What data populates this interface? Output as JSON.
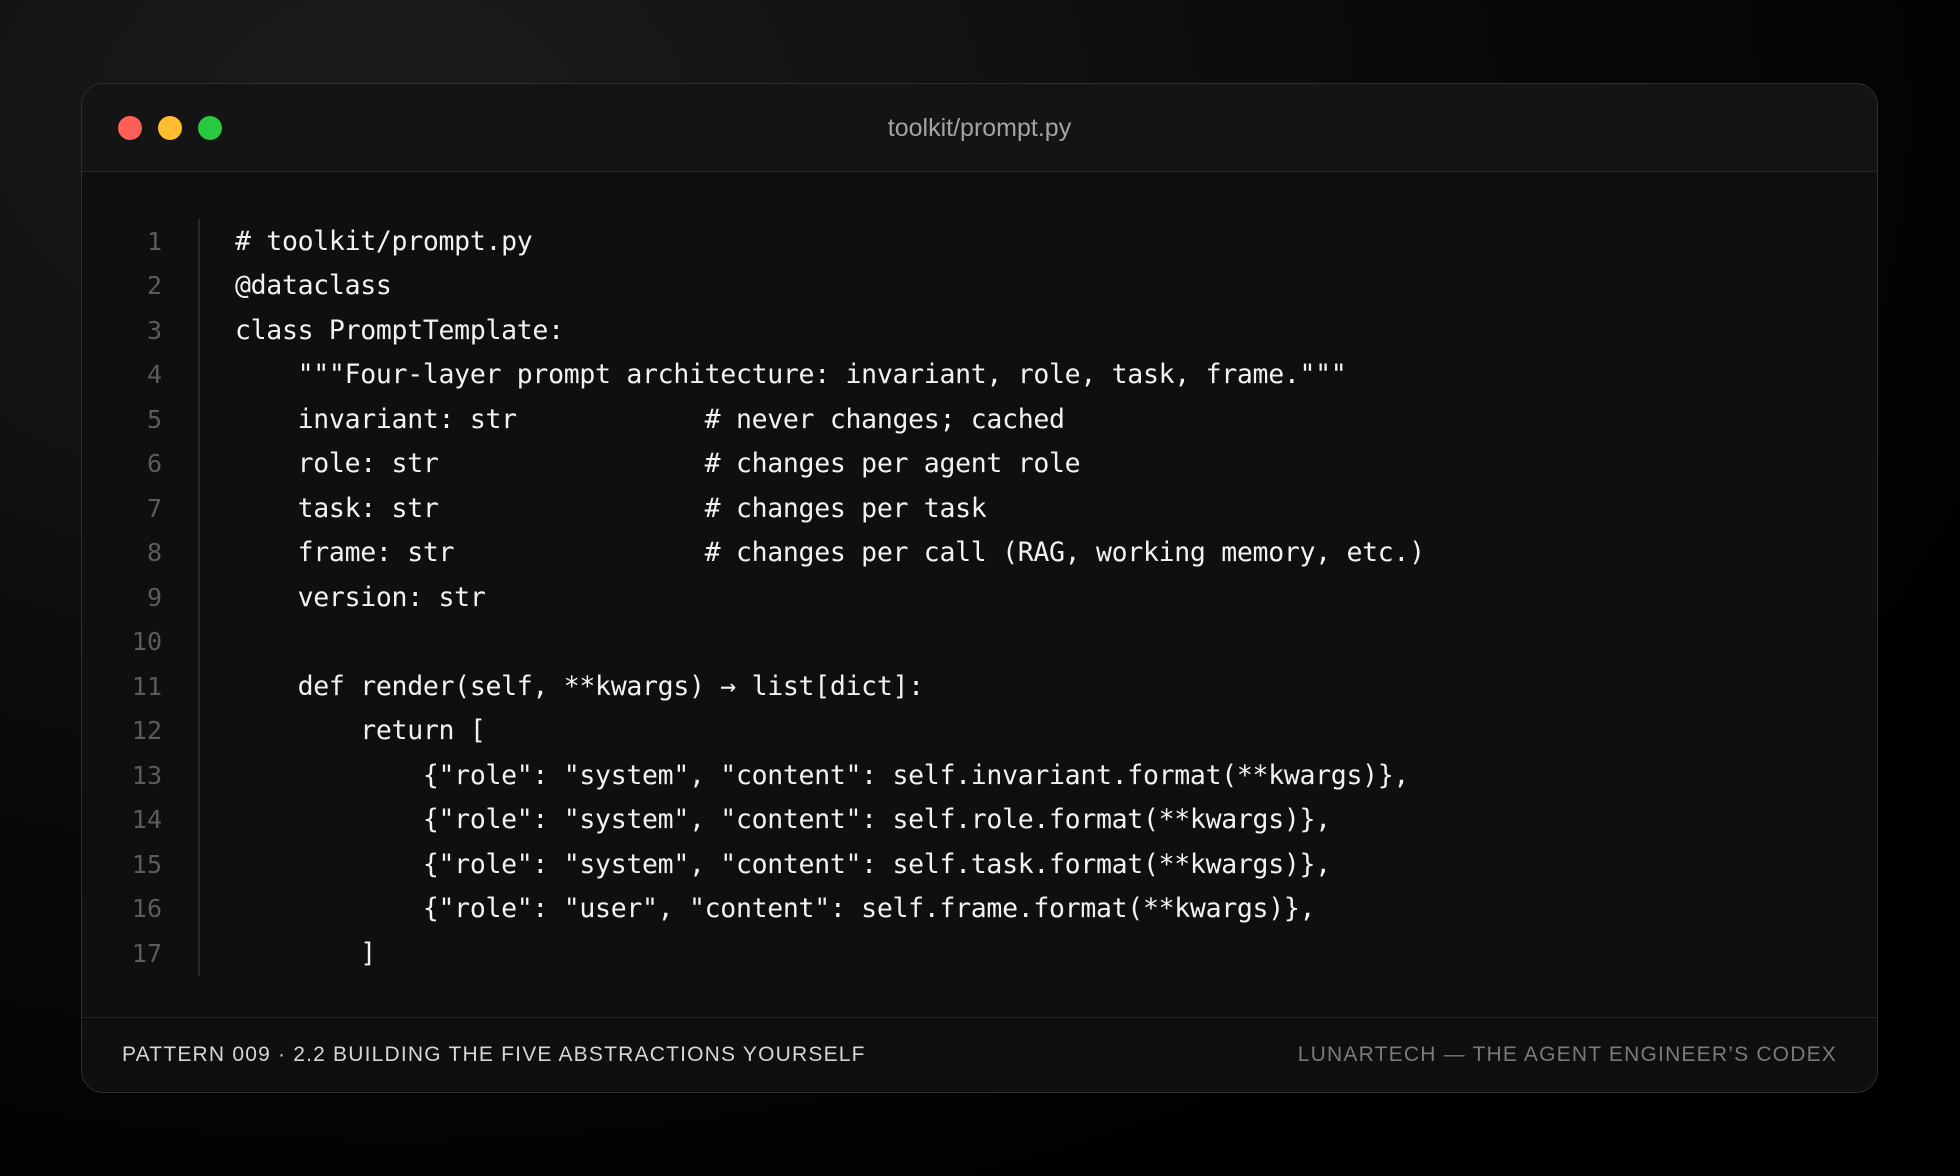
{
  "window": {
    "title": "toolkit/prompt.py",
    "controls": {
      "close_color": "#ff5f57",
      "minimize_color": "#febc2e",
      "maximize_color": "#28c840"
    }
  },
  "code": {
    "language": "python",
    "lines": [
      {
        "number": "1",
        "text": "# toolkit/prompt.py"
      },
      {
        "number": "2",
        "text": "@dataclass"
      },
      {
        "number": "3",
        "text": "class PromptTemplate:"
      },
      {
        "number": "4",
        "text": "    \"\"\"Four-layer prompt architecture: invariant, role, task, frame.\"\"\""
      },
      {
        "number": "5",
        "text": "    invariant: str            # never changes; cached"
      },
      {
        "number": "6",
        "text": "    role: str                 # changes per agent role"
      },
      {
        "number": "7",
        "text": "    task: str                 # changes per task"
      },
      {
        "number": "8",
        "text": "    frame: str                # changes per call (RAG, working memory, etc.)"
      },
      {
        "number": "9",
        "text": "    version: str"
      },
      {
        "number": "10",
        "text": ""
      },
      {
        "number": "11",
        "text": "    def render(self, **kwargs) → list[dict]:"
      },
      {
        "number": "12",
        "text": "        return ["
      },
      {
        "number": "13",
        "text": "            {\"role\": \"system\", \"content\": self.invariant.format(**kwargs)},"
      },
      {
        "number": "14",
        "text": "            {\"role\": \"system\", \"content\": self.role.format(**kwargs)},"
      },
      {
        "number": "15",
        "text": "            {\"role\": \"system\", \"content\": self.task.format(**kwargs)},"
      },
      {
        "number": "16",
        "text": "            {\"role\": \"user\", \"content\": self.frame.format(**kwargs)},"
      },
      {
        "number": "17",
        "text": "        ]"
      }
    ]
  },
  "footer": {
    "left": "PATTERN 009 · 2.2 BUILDING THE FIVE ABSTRACTIONS YOURSELF",
    "right": "LUNARTECH — THE AGENT ENGINEER’S CODEX"
  }
}
